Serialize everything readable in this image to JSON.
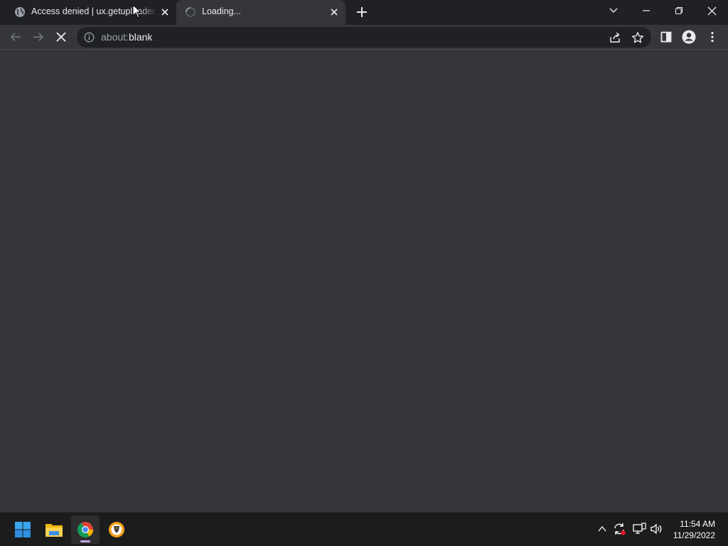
{
  "browser": {
    "tabs": [
      {
        "title": "Access denied | ux.getuploader.com",
        "favicon": "globe-icon",
        "active": false
      },
      {
        "title": "Loading...",
        "favicon": "loading-spinner-icon",
        "active": true
      }
    ],
    "address_bar": {
      "scheme": "about:",
      "path": "blank"
    },
    "colors": {
      "frame": "#202124",
      "toolbar": "#35363a",
      "omnibox": "#202124",
      "text": "#e8eaed",
      "muted": "#9aa0a6"
    }
  },
  "taskbar": {
    "apps": [
      "start-icon",
      "file-explorer-icon",
      "chrome-icon",
      "brave-icon"
    ],
    "tray_icons": [
      "show-hidden-icons",
      "sync-icon",
      "network-icon",
      "volume-icon"
    ],
    "clock": {
      "time": "11:54 AM",
      "date": "11/29/2022"
    }
  }
}
